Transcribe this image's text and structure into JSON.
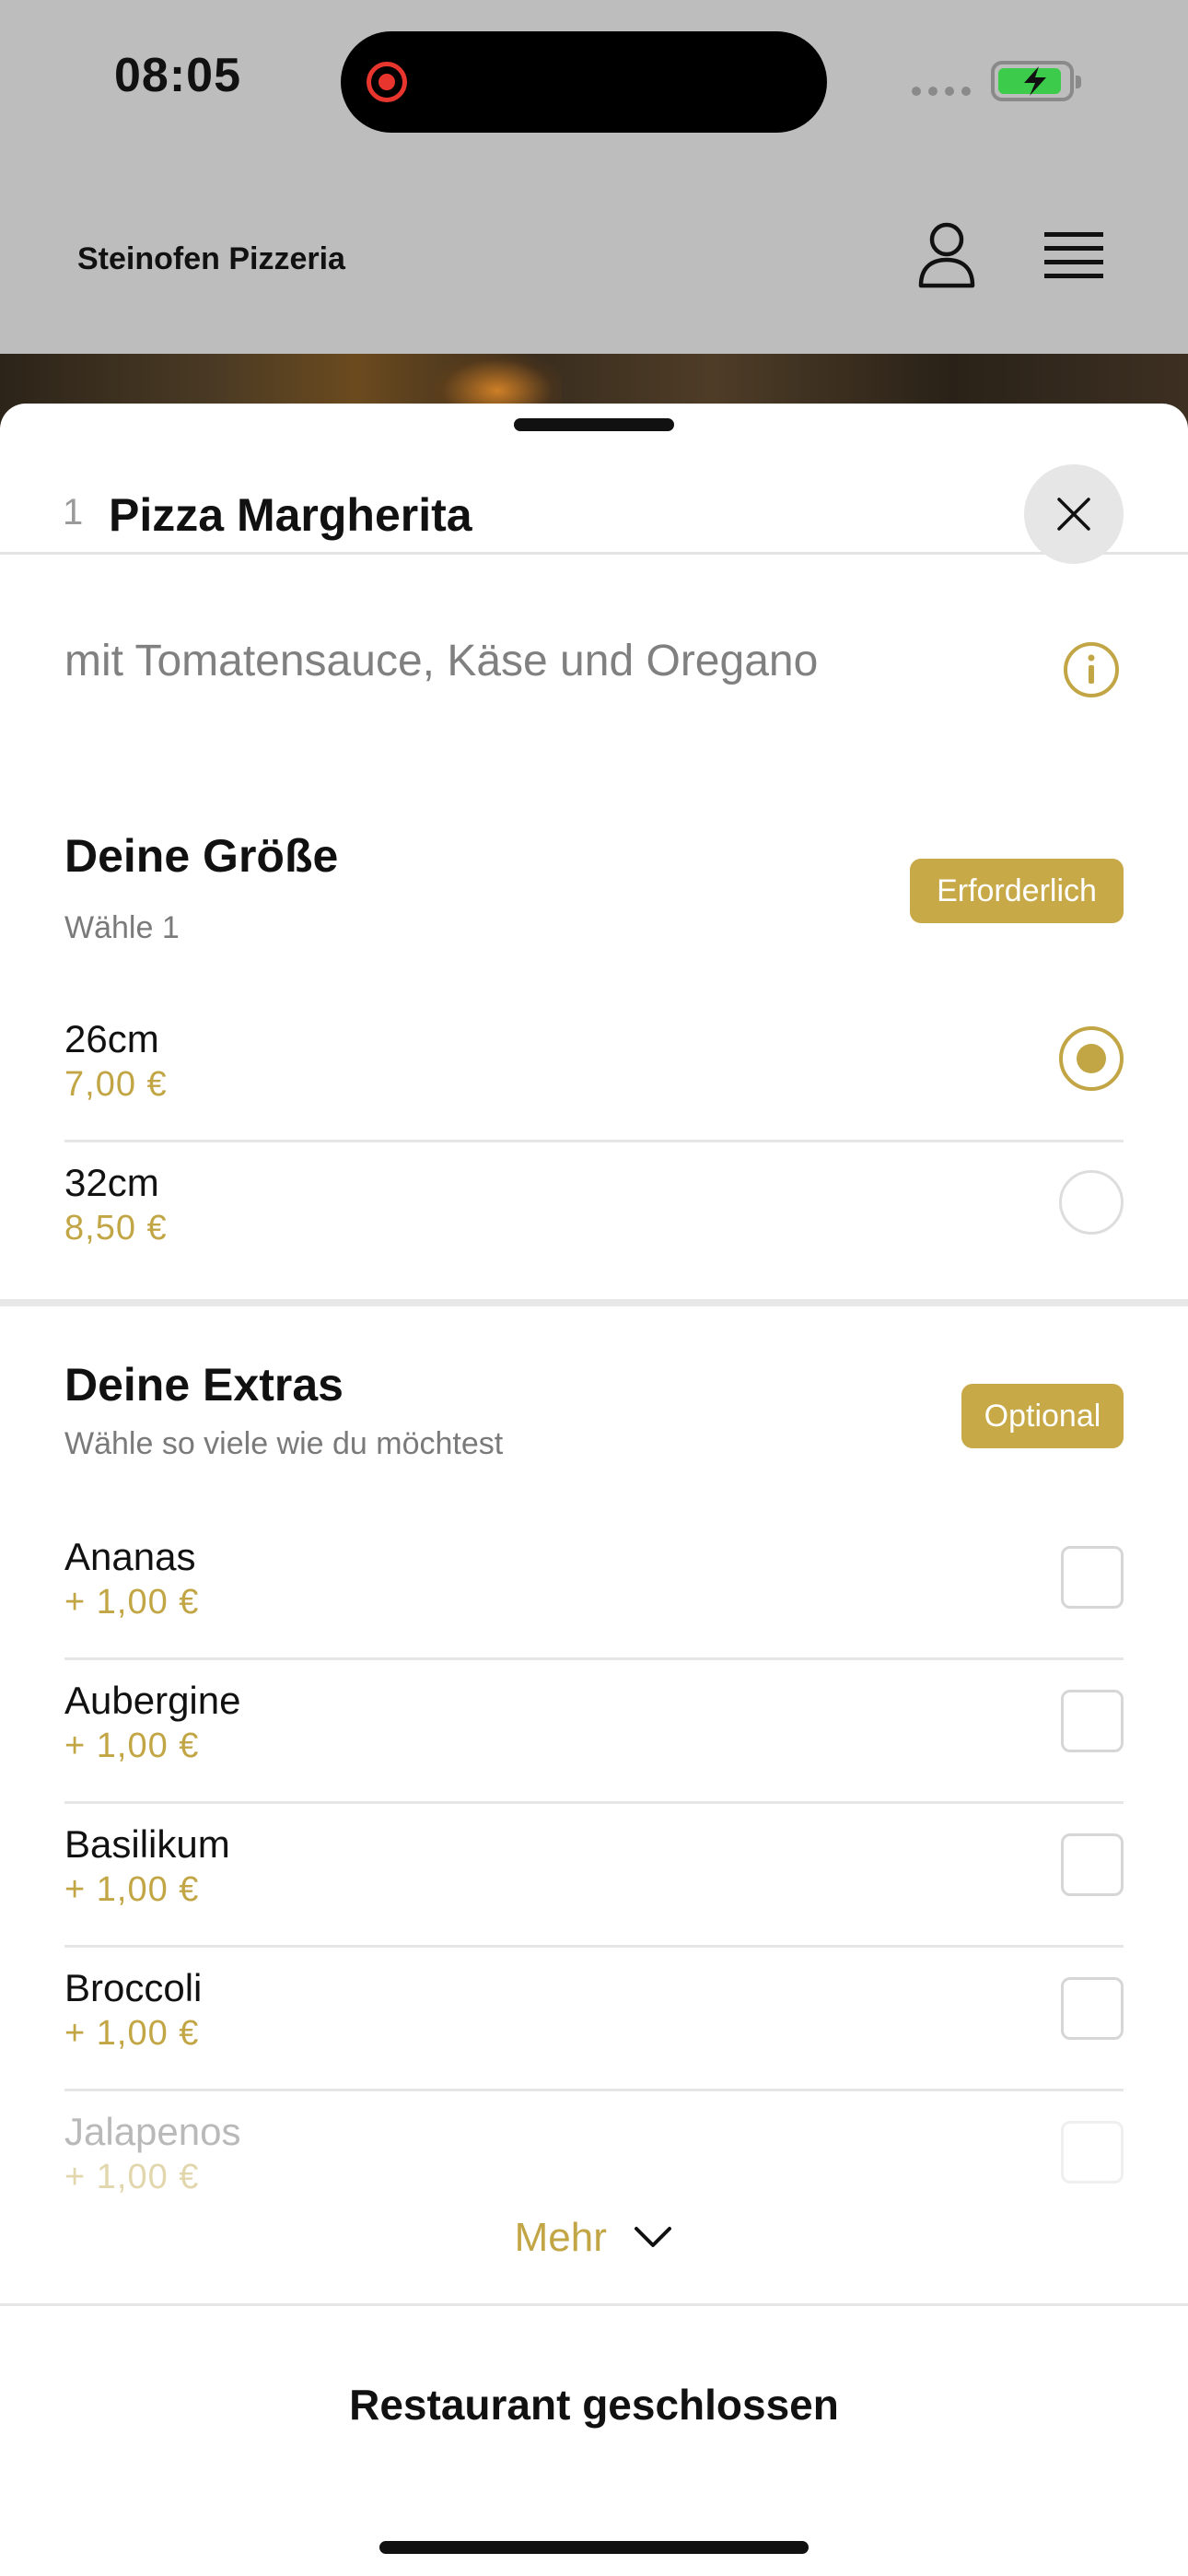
{
  "status_bar": {
    "time": "08:05"
  },
  "header": {
    "brand": "Steinofen Pizzeria"
  },
  "item": {
    "quantity": "1",
    "title": "Pizza Margherita",
    "description": "mit Tomatensauce, Käse und Oregano"
  },
  "size_section": {
    "title": "Deine Größe",
    "subtitle": "Wähle 1",
    "badge": "Erforderlich",
    "options": [
      {
        "name": "26cm",
        "price": "7,00 €",
        "selected": true
      },
      {
        "name": "32cm",
        "price": "8,50 €",
        "selected": false
      }
    ]
  },
  "extras_section": {
    "title": "Deine Extras",
    "subtitle": "Wähle so viele wie du möchtest",
    "badge": "Optional",
    "options": [
      {
        "name": "Ananas",
        "price": "+ 1,00 €"
      },
      {
        "name": "Aubergine",
        "price": "+ 1,00 €"
      },
      {
        "name": "Basilikum",
        "price": "+ 1,00 €"
      },
      {
        "name": "Broccoli",
        "price": "+ 1,00 €"
      },
      {
        "name": "Jalapenos",
        "price": "+ 1,00 €"
      }
    ]
  },
  "more_label": "Mehr",
  "footer_label": "Restaurant geschlossen",
  "colors": {
    "accent": "#c2a646",
    "badge": "#c7a948",
    "battery": "#3dcb4b",
    "record": "#e8352e"
  }
}
